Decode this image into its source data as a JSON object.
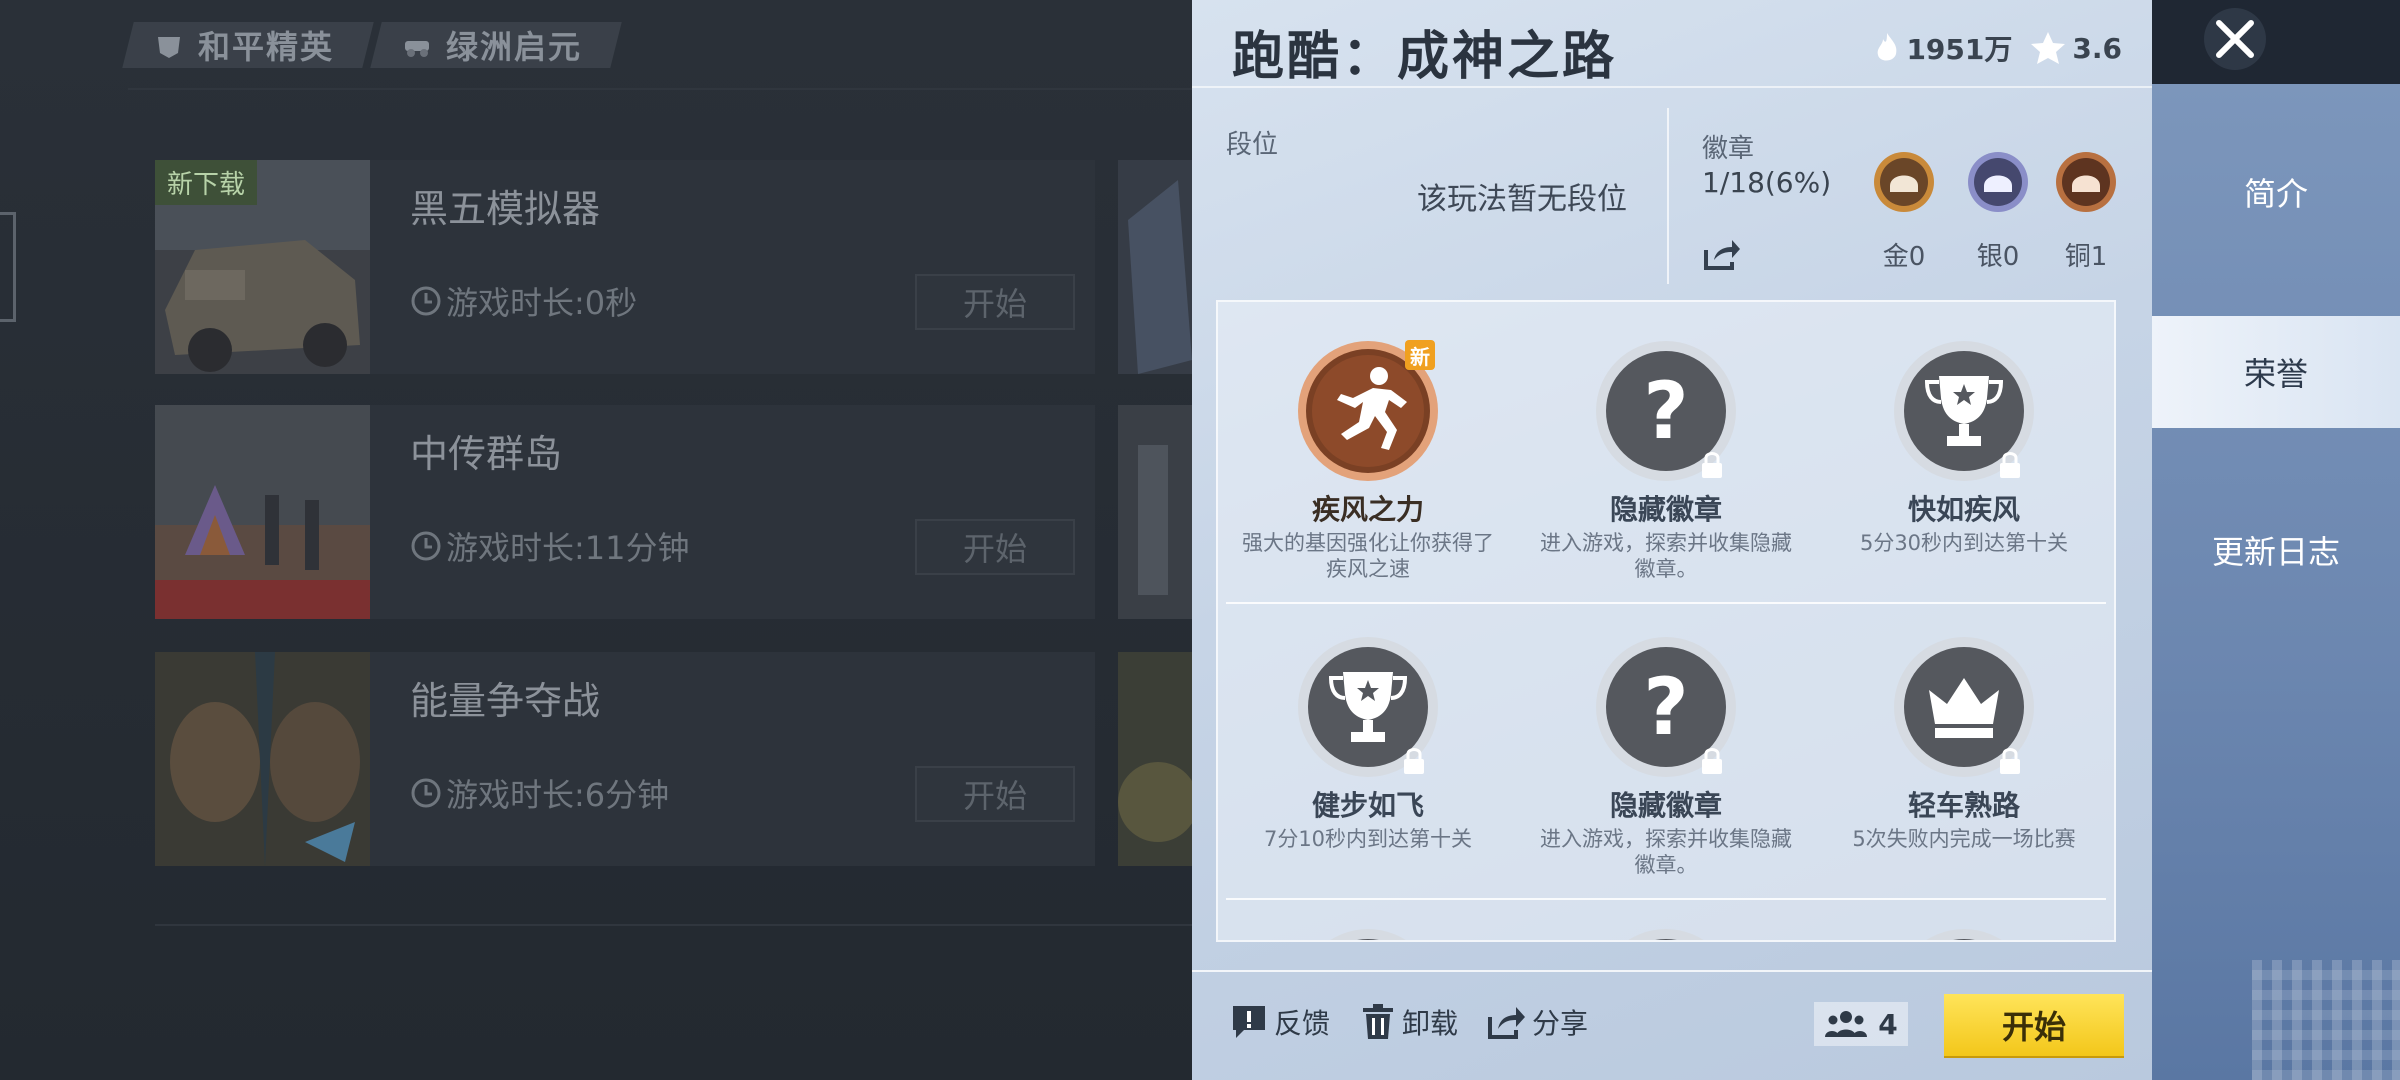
{
  "library": {
    "tabs": [
      {
        "label": "和平精英"
      },
      {
        "label": "绿洲启元"
      }
    ],
    "new_tag": "新下载",
    "games": [
      {
        "name": "黑五模拟器",
        "playtime": "游戏时长:0秒",
        "start_label": "开始"
      },
      {
        "name": "中传群岛",
        "playtime": "游戏时长:11分钟",
        "start_label": "开始"
      },
      {
        "name": "能量争夺战",
        "playtime": "游戏时长:6分钟",
        "start_label": "开始"
      }
    ]
  },
  "panel": {
    "title": "跑酷：成神之路",
    "heat": "1951万",
    "rating": "3.6",
    "rank": {
      "label": "段位",
      "value": "该玩法暂无段位"
    },
    "badges": {
      "label": "徽章",
      "count": "1/18(6%)",
      "tiers": [
        {
          "label": "金0",
          "color": "#c98a3a"
        },
        {
          "label": "银0",
          "color": "#6b6fa8"
        },
        {
          "label": "铜1",
          "color": "#a0603a"
        }
      ]
    },
    "achievements": [
      {
        "name": "疾风之力",
        "desc": "强大的基因强化让你获得了疾风之速",
        "icon": "runner-icon",
        "unlocked": true,
        "is_new": true
      },
      {
        "name": "隐藏徽章",
        "desc": "进入游戏，探索并收集隐藏徽章。",
        "icon": "question-icon",
        "unlocked": false,
        "is_new": false
      },
      {
        "name": "快如疾风",
        "desc": "5分30秒内到达第十关",
        "icon": "trophy-icon",
        "unlocked": false,
        "is_new": false
      },
      {
        "name": "健步如飞",
        "desc": "7分10秒内到达第十关",
        "icon": "trophy-icon",
        "unlocked": false,
        "is_new": false
      },
      {
        "name": "隐藏徽章",
        "desc": "进入游戏，探索并收集隐藏徽章。",
        "icon": "question-icon",
        "unlocked": false,
        "is_new": false
      },
      {
        "name": "轻车熟路",
        "desc": "5次失败内完成一场比赛",
        "icon": "crown-icon",
        "unlocked": false,
        "is_new": false
      }
    ],
    "new_badge_label": "新",
    "footer": {
      "feedback": "反馈",
      "uninstall": "卸载",
      "share": "分享",
      "players": "4",
      "start": "开始"
    }
  },
  "sidenav": {
    "items": [
      {
        "label": "简介",
        "active": false
      },
      {
        "label": "荣誉",
        "active": true
      },
      {
        "label": "更新日志",
        "active": false
      }
    ]
  },
  "colors": {
    "start_button": "#f3c71a",
    "panel_bg": "#c6d4e6",
    "unlocked_medal": "#8a4a2a",
    "locked_medal": "#5a5e66"
  }
}
